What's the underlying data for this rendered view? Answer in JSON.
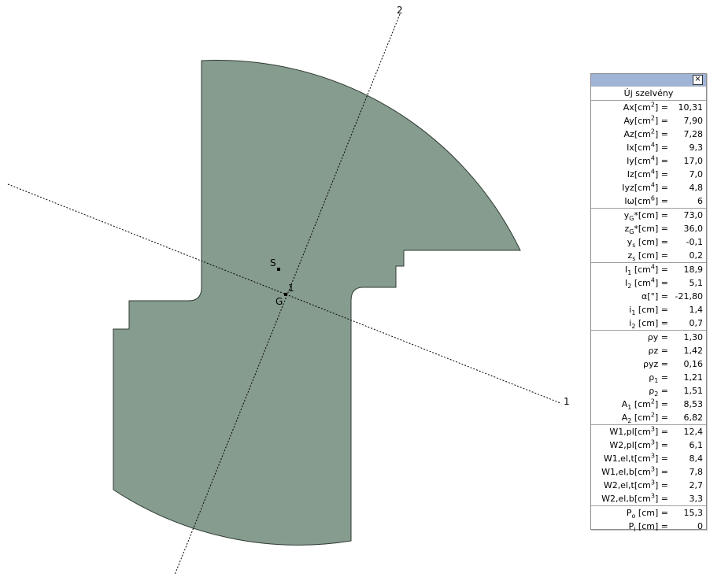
{
  "colors": {
    "section_fill": "#869c8e",
    "section_stroke": "#2f3a33",
    "panel_title": "#9fb4d6"
  },
  "drawing": {
    "axis_1_label": "1",
    "axis_1_label_near": "1",
    "axis_2_label": "2",
    "point_s_label": "S",
    "point_g_label": "G"
  },
  "panel": {
    "close_icon": "×",
    "section_name": "Új szelvény",
    "groups": [
      [
        {
          "k": "Ax",
          "u": "[cm",
          "e": "2",
          "s": "] =",
          "v": "10,31"
        },
        {
          "k": "Ay",
          "u": "[cm",
          "e": "2",
          "s": "] =",
          "v": "7,90"
        },
        {
          "k": "Az",
          "u": "[cm",
          "e": "2",
          "s": "] =",
          "v": "7,28"
        },
        {
          "k": "Ix",
          "u": "[cm",
          "e": "4",
          "s": "] =",
          "v": "9,3"
        },
        {
          "k": "Iy",
          "u": "[cm",
          "e": "4",
          "s": "] =",
          "v": "17,0"
        },
        {
          "k": "Iz",
          "u": "[cm",
          "e": "4",
          "s": "] =",
          "v": "7,0"
        },
        {
          "k": "Iyz",
          "u": "[cm",
          "e": "4",
          "s": "] =",
          "v": "4,8"
        },
        {
          "k": "Iω",
          "u": "[cm",
          "e": "6",
          "s": "] =",
          "v": "6"
        }
      ],
      [
        {
          "k": "y",
          "b": "G",
          "u": "*[cm]",
          "s": " =",
          "v": "73,0"
        },
        {
          "k": "z",
          "b": "G",
          "u": "*[cm]",
          "s": " =",
          "v": "36,0"
        },
        {
          "k": "y",
          "b": "s",
          "u": " [cm]",
          "s": " =",
          "v": "-0,1"
        },
        {
          "k": "z",
          "b": "s",
          "u": " [cm]",
          "s": " =",
          "v": "0,2"
        }
      ],
      [
        {
          "k": "I",
          "b": "1",
          "u": " [cm",
          "e": "4",
          "s": "] =",
          "v": "18,9"
        },
        {
          "k": "I",
          "b": "2",
          "u": " [cm",
          "e": "4",
          "s": "] =",
          "v": "5,1"
        },
        {
          "k": "α[°]",
          "s": " =",
          "v": "-21,80"
        },
        {
          "k": "i",
          "b": "1",
          "u": " [cm]",
          "s": " =",
          "v": "1,4"
        },
        {
          "k": "i",
          "b": "2",
          "u": " [cm]",
          "s": " =",
          "v": "0,7"
        }
      ],
      [
        {
          "k": "ρy",
          "s": " =",
          "v": "1,30"
        },
        {
          "k": "ρz",
          "s": " =",
          "v": "1,42"
        },
        {
          "k": "ρyz",
          "s": " =",
          "v": "0,16"
        },
        {
          "k": "ρ",
          "b": "1",
          "s": " =",
          "v": "1,21"
        },
        {
          "k": "ρ",
          "b": "2",
          "s": " =",
          "v": "1,51"
        },
        {
          "k": "A",
          "b": "1",
          "u": " [cm",
          "e": "2",
          "s": "] =",
          "v": "8,53"
        },
        {
          "k": "A",
          "b": "2",
          "u": " [cm",
          "e": "2",
          "s": "] =",
          "v": "6,82"
        }
      ],
      [
        {
          "k": "W1,pl",
          "u": "[cm",
          "e": "3",
          "s": "] =",
          "v": "12,4"
        },
        {
          "k": "W2,pl",
          "u": "[cm",
          "e": "3",
          "s": "] =",
          "v": "6,1"
        },
        {
          "k": "W1,el,t",
          "u": "[cm",
          "e": "3",
          "s": "] =",
          "v": "8,4"
        },
        {
          "k": "W1,el,b",
          "u": "[cm",
          "e": "3",
          "s": "] =",
          "v": "7,8"
        },
        {
          "k": "W2,el,t",
          "u": "[cm",
          "e": "3",
          "s": "] =",
          "v": "2,7"
        },
        {
          "k": "W2,el,b",
          "u": "[cm",
          "e": "3",
          "s": "] =",
          "v": "3,3"
        }
      ],
      [
        {
          "k": "P",
          "b": "o",
          "u": " [cm]",
          "s": " =",
          "v": "15,3"
        },
        {
          "k": "P",
          "b": "i",
          "u": " [cm]",
          "s": " =",
          "v": "0"
        }
      ]
    ]
  }
}
